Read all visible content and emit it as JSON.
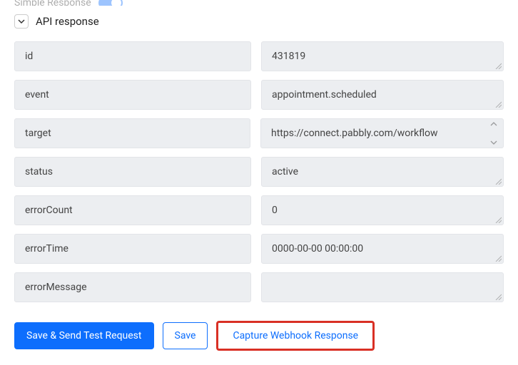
{
  "top": {
    "label": "Simple Response"
  },
  "section": {
    "title": "API response"
  },
  "pairs": [
    {
      "key": "id",
      "value": "431819"
    },
    {
      "key": "event",
      "value": "appointment.scheduled"
    },
    {
      "key": "target",
      "value": "https://connect.pabbly.com/workflow"
    },
    {
      "key": "status",
      "value": "active"
    },
    {
      "key": "errorCount",
      "value": "0"
    },
    {
      "key": "errorTime",
      "value": "0000-00-00 00:00:00"
    },
    {
      "key": "errorMessage",
      "value": ""
    }
  ],
  "buttons": {
    "save_send": "Save & Send Test Request",
    "save": "Save",
    "capture": "Capture Webhook Response"
  },
  "colors": {
    "primary": "#0d6efd",
    "highlight_border": "#d93025",
    "field_bg": "#eceef1"
  }
}
